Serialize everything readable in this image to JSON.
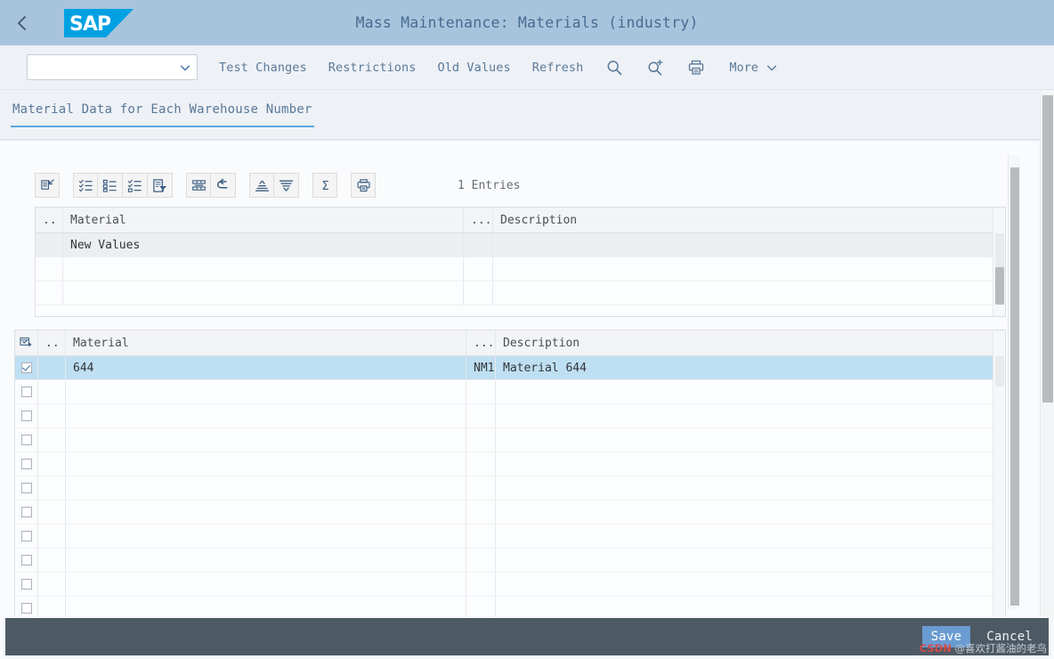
{
  "shell": {
    "back_icon": "chevron-left-icon",
    "logo_text": "SAP",
    "title": "Mass Maintenance: Materials (industry)"
  },
  "toolbar": {
    "variant_select": {
      "value": "",
      "placeholder": ""
    },
    "items": [
      {
        "label": "Test Changes",
        "name": "test-changes"
      },
      {
        "label": "Restrictions",
        "name": "restrictions"
      },
      {
        "label": "Old Values",
        "name": "old-values"
      },
      {
        "label": "Refresh",
        "name": "refresh"
      }
    ],
    "icons": [
      {
        "name": "search-icon"
      },
      {
        "name": "search-plus-icon"
      },
      {
        "name": "print-icon"
      }
    ],
    "more_label": "More"
  },
  "tabs": [
    {
      "label": "Material Data for Each Warehouse Number",
      "active": true
    }
  ],
  "grid_toolbar": {
    "buttons": [
      {
        "name": "collapse-grid-button"
      },
      {
        "name": "select-all-button"
      },
      {
        "name": "select-block-button"
      },
      {
        "name": "deselect-all-button"
      },
      {
        "name": "filter-button"
      },
      {
        "name": "layout-button"
      },
      {
        "name": "undo-button"
      },
      {
        "name": "sort-ascending-button"
      },
      {
        "name": "sort-descending-button"
      },
      {
        "name": "sum-button"
      },
      {
        "name": "print-grid-button"
      }
    ],
    "entries_label": "1 Entries"
  },
  "upper_table": {
    "columns": [
      "..",
      "Material",
      "...",
      "Description"
    ],
    "rows": [
      {
        "type": "newvalues",
        "cells": [
          "",
          "New Values",
          "",
          ""
        ]
      },
      {
        "type": "blank",
        "cells": [
          "",
          "",
          "",
          ""
        ]
      },
      {
        "type": "blank",
        "cells": [
          "",
          "",
          "",
          ""
        ]
      }
    ]
  },
  "lower_table": {
    "select_all_icon": "select-all-layout-icon",
    "columns": [
      "..",
      "Material",
      "...",
      "Description"
    ],
    "rows": [
      {
        "checked": true,
        "cells": [
          "644",
          "NM1",
          "Material 644"
        ]
      },
      {
        "checked": false,
        "cells": [
          "",
          "",
          ""
        ]
      },
      {
        "checked": false,
        "cells": [
          "",
          "",
          ""
        ]
      },
      {
        "checked": false,
        "cells": [
          "",
          "",
          ""
        ]
      },
      {
        "checked": false,
        "cells": [
          "",
          "",
          ""
        ]
      },
      {
        "checked": false,
        "cells": [
          "",
          "",
          ""
        ]
      },
      {
        "checked": false,
        "cells": [
          "",
          "",
          ""
        ]
      },
      {
        "checked": false,
        "cells": [
          "",
          "",
          ""
        ]
      },
      {
        "checked": false,
        "cells": [
          "",
          "",
          ""
        ]
      },
      {
        "checked": false,
        "cells": [
          "",
          "",
          ""
        ]
      },
      {
        "checked": false,
        "cells": [
          "",
          "",
          ""
        ]
      }
    ]
  },
  "footer": {
    "save_label": "Save",
    "cancel_label": "Cancel"
  },
  "watermark": {
    "prefix": "CSDN",
    "suffix": " @喜欢打酱油的老鸟"
  },
  "colors": {
    "shell_header": "#a8c4dd",
    "accent_blue": "#5ba7e0",
    "toolbar_bg": "#eef1f6",
    "footer_bg": "#4d5a64",
    "selected_row": "#bfdff3",
    "primary_button": "#6a9bd1",
    "sap_logo_blue": "#00a0e3"
  }
}
